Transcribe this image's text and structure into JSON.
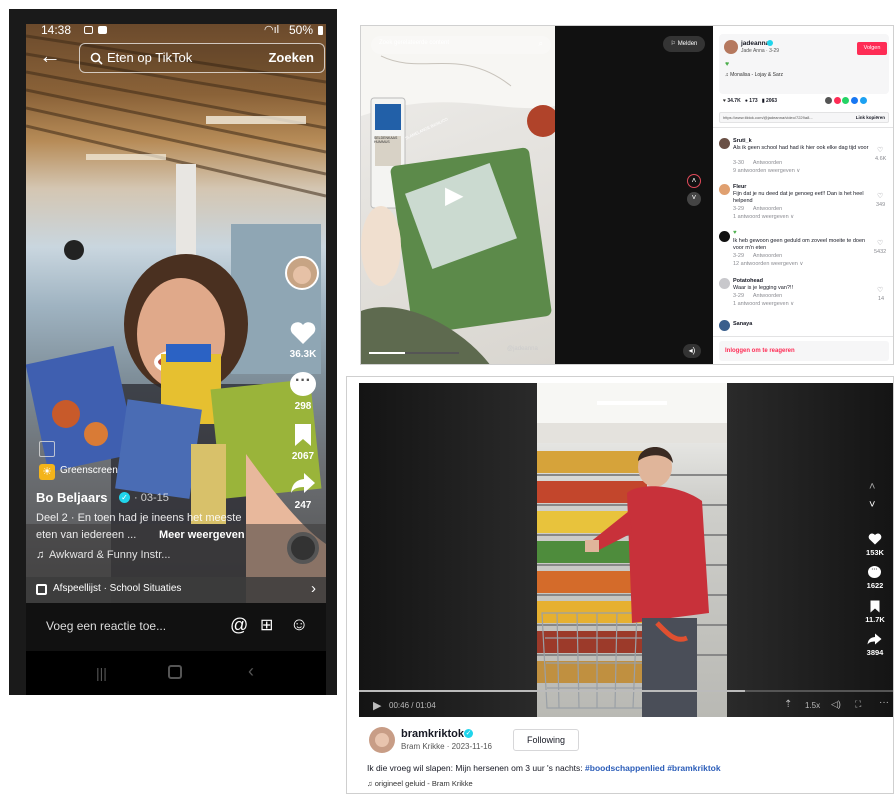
{
  "phone": {
    "status": {
      "time": "14:38",
      "battery": "50%"
    },
    "search": {
      "query": "Eten op TikTok",
      "button": "Zoeken"
    },
    "side": {
      "likes": "36.3K",
      "comments": "298",
      "saves": "2067",
      "shares": "247"
    },
    "effect_label": "Greenscreen",
    "author": "Bo Beljaars",
    "date": "· 03-15",
    "caption": "Deel 2 · En toen had je ineens het meeste",
    "caption_line2": "eten van iedereen ...",
    "more": "Meer weergeven",
    "music": "Awkward & Funny Instr...",
    "playlist": "Afspeellijst · School Situaties",
    "comment_placeholder": "Voeg een reactie toe...",
    "colors": {
      "like": "#ffffff",
      "verified": "#20d5ec",
      "effect_badge": "#f4b41a"
    }
  },
  "desktop1": {
    "search_placeholder": "Zoek gerelateerde content",
    "report": "Melden",
    "watermark": "@jadeanna",
    "author": {
      "handle": "jadeanna",
      "name": "Jade Anna · 3-29"
    },
    "follow_button": "Volgen",
    "music": "Monalisa - Lojay & Sarz",
    "stats": {
      "likes": "34.7K",
      "comments": "173",
      "saves": "2063"
    },
    "link": "https://www.tiktok.com/@jadeanna/video/7229a8...",
    "copy_link": "Link kopiëren",
    "comments": [
      {
        "user": "Sruti_k",
        "text": "Als ik geen school had had ik hier ook elke dag tijd voor",
        "meta": "3-30      Antwoorden",
        "replies": "9 antwoorden weergeven ∨",
        "likes": "4.6K"
      },
      {
        "user": "Fleur",
        "text": "Fijn dat je nu deed dat je genoeg eet!! Dan is het heel helpend",
        "meta": "3-29      Antwoorden",
        "replies": "1 antwoord weergeven ∨",
        "likes": "349"
      },
      {
        "user": "",
        "text": "Ik heb gewoon geen geduld om zoveel moeite te doen voor m'n eten",
        "meta": "3-29      Antwoorden",
        "replies": "12 antwoorden weergeven ∨",
        "likes": "5432"
      },
      {
        "user": "Potatohead",
        "text": "Waar is je legging van?!!",
        "meta": "3-29      Antwoorden",
        "replies": "1 antwoord weergeven ∨",
        "likes": "14"
      },
      {
        "user": "Sanaya",
        "text": "",
        "meta": "",
        "replies": "",
        "likes": ""
      }
    ],
    "login_prompt": "Inloggen om te reageren",
    "product_label": "SELDENKAAS HUMMUS",
    "bag_label": "SLAMELANGE BASILICO"
  },
  "desktop2": {
    "time": "00:46 / 01:04",
    "speed": "1.5x",
    "side": {
      "likes": "153K",
      "comments": "1622",
      "saves": "11.7K",
      "shares": "3894"
    },
    "author": {
      "handle": "bramkriktok",
      "name": "Bram Krikke · 2023-11-16"
    },
    "follow_button": "Following",
    "caption": "Ik die vroeg wil slapen: Mijn hersenen om 3 uur 's nachts:",
    "hashtags": "#boodschappenlied #bramkriktok",
    "music": "origineel geluid - Bram Krikke",
    "progress": 0.72
  }
}
